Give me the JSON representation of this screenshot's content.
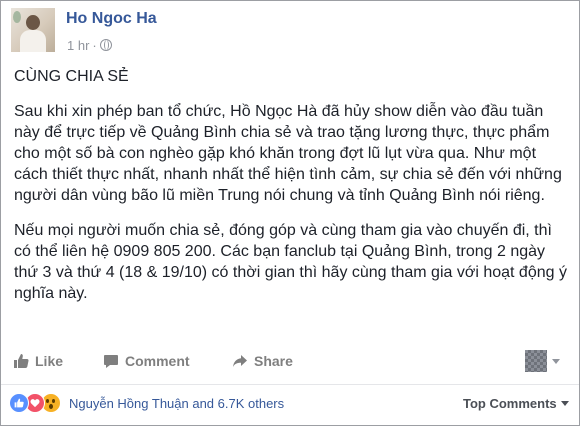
{
  "post": {
    "author": "Ho Ngoc Ha",
    "time": "1 hr",
    "separator": "·",
    "privacy_icon": "globe-icon"
  },
  "content": {
    "heading": "CÙNG CHIA SẺ",
    "paragraph_1": "Sau khi xin phép ban tổ chức, Hồ Ngọc Hà đã hủy show diễn vào đầu tuần này để trực tiếp về Quảng Bình chia sẻ và trao tặng lương thực, thực phẩm cho một số bà con nghèo gặp khó khăn trong đợt lũ lụt vừa qua. Như một cách thiết thực nhất, nhanh nhất thể hiện tình cảm, sự chia sẻ đến với những người dân vùng bão lũ miền Trung nói chung và tỉnh Quảng Bình nói riêng.",
    "paragraph_2": "Nếu mọi người muốn chia sẻ, đóng góp và cùng tham gia vào chuyến đi, thì có thể liên hệ 0909 805 200. Các bạn fanclub tại Quảng Bình, trong 2 ngày thứ 3 và thứ 4 (18 & 19/10) có thời gian thì hãy cùng tham gia với hoạt động ý nghĩa này."
  },
  "actions": {
    "like_label": "Like",
    "comment_label": "Comment",
    "share_label": "Share"
  },
  "reactions": {
    "icons": [
      "like-icon",
      "love-icon",
      "wow-icon"
    ],
    "summary": "Nguyễn Hồng Thuận and 6.7K others",
    "sort_label": "Top Comments"
  },
  "colors": {
    "link_blue": "#365899",
    "text": "#1d2129",
    "muted": "#90949c",
    "like": "#5890ff",
    "love": "#f25268",
    "wow": "#f7b125"
  }
}
